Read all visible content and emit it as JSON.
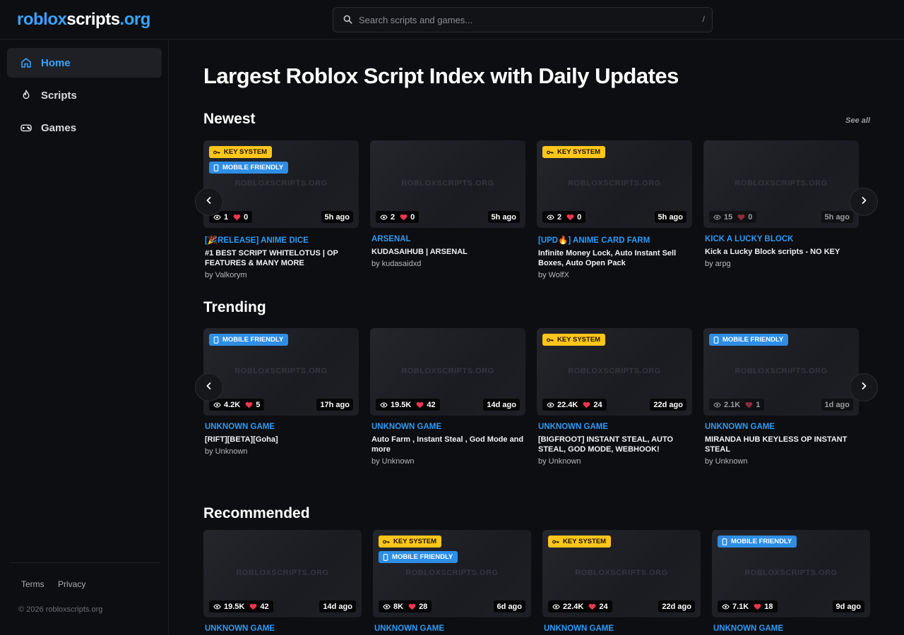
{
  "header": {
    "logo": {
      "part1": "roblox",
      "part2": "scripts",
      "part3": ".org"
    },
    "search_placeholder": "Search scripts and games...",
    "search_shortcut": "/"
  },
  "sidebar": {
    "items": [
      {
        "label": "Home",
        "icon": "home-icon",
        "active": true
      },
      {
        "label": "Scripts",
        "icon": "flame-icon",
        "active": false
      },
      {
        "label": "Games",
        "icon": "gamepad-icon",
        "active": false
      }
    ],
    "footer_links": [
      "Terms",
      "Privacy"
    ],
    "copyright": "© 2026 robloxscripts.org"
  },
  "main": {
    "heading": "Largest Roblox Script Index with Daily Updates",
    "watermark": "ROBLOXSCRIPTS.ORG",
    "badges": {
      "key": "KEY SYSTEM",
      "mobile": "MOBILE FRIENDLY"
    },
    "sections": [
      {
        "title": "Newest",
        "see_all": "See all",
        "cards": [
          {
            "badges": [
              "key",
              "mobile"
            ],
            "views": "1",
            "likes": "0",
            "age": "5h ago",
            "game": "[🎉RELEASE] ANIME DICE",
            "title": "#1 BEST SCRIPT WHITELOTUS | OP FEATURES & MANY MORE",
            "author": "by Valkorym"
          },
          {
            "badges": [],
            "views": "2",
            "likes": "0",
            "age": "5h ago",
            "game": "ARSENAL",
            "title": "KUDASAIHUB | ARSENAL",
            "author": "by kudasaidxd"
          },
          {
            "badges": [
              "key"
            ],
            "views": "2",
            "likes": "0",
            "age": "5h ago",
            "game": "[UPD🔥] ANIME CARD FARM",
            "title": "Infinite Money Lock, Auto Instant Sell Boxes, Auto Open Pack",
            "author": "by WolfX"
          },
          {
            "badges": [],
            "views": "15",
            "likes": "0",
            "age": "5h ago",
            "game": "KICK A LUCKY BLOCK",
            "title": "Kick a Lucky Block scripts - NO KEY",
            "author": "by arpg"
          }
        ]
      },
      {
        "title": "Trending",
        "cards": [
          {
            "badges": [
              "mobile"
            ],
            "views": "4.2K",
            "likes": "5",
            "age": "17h ago",
            "game": "UNKNOWN GAME",
            "title": "[RIFT][BETA][Goha]",
            "author": "by Unknown"
          },
          {
            "badges": [],
            "views": "19.5K",
            "likes": "42",
            "age": "14d ago",
            "game": "UNKNOWN GAME",
            "title": "Auto Farm , Instant Steal , God Mode and more",
            "author": "by Unknown"
          },
          {
            "badges": [
              "key"
            ],
            "views": "22.4K",
            "likes": "24",
            "age": "22d ago",
            "game": "UNKNOWN GAME",
            "title": "[BIGFROOT] INSTANT STEAL, AUTO STEAL, GOD MODE, WEBHOOK!",
            "author": "by Unknown"
          },
          {
            "badges": [
              "mobile"
            ],
            "views": "2.1K",
            "likes": "1",
            "age": "1d ago",
            "game": "UNKNOWN GAME",
            "title": "MIRANDA HUB KEYLESS OP INSTANT STEAL",
            "author": "by Unknown"
          }
        ]
      },
      {
        "title": "Recommended",
        "cards": [
          {
            "badges": [],
            "views": "19.5K",
            "likes": "42",
            "age": "14d ago",
            "game": "UNKNOWN GAME",
            "title": "",
            "author": ""
          },
          {
            "badges": [
              "key",
              "mobile"
            ],
            "views": "8K",
            "likes": "28",
            "age": "6d ago",
            "game": "UNKNOWN GAME",
            "title": "",
            "author": ""
          },
          {
            "badges": [
              "key"
            ],
            "views": "22.4K",
            "likes": "24",
            "age": "22d ago",
            "game": "UNKNOWN GAME",
            "title": "",
            "author": ""
          },
          {
            "badges": [
              "mobile"
            ],
            "views": "7.1K",
            "likes": "18",
            "age": "9d ago",
            "game": "UNKNOWN GAME",
            "title": "",
            "author": ""
          }
        ]
      }
    ]
  },
  "colors": {
    "accent": "#3aa3ff",
    "key_badge": "#ffc61a",
    "mobile_badge": "#2e8ee6",
    "heart": "#f0364f"
  },
  "icons": {
    "search": "search-icon",
    "eye": "eye-icon",
    "heart": "heart-icon",
    "key": "key-icon",
    "phone": "phone-icon",
    "prev": "chevron-left-icon",
    "next": "chevron-right-icon"
  }
}
